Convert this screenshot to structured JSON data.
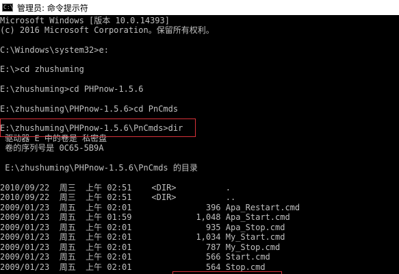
{
  "window": {
    "title": "管理员: 命令提示符",
    "icon": "cmd-window-icon",
    "icon_text": "C:\\"
  },
  "console": {
    "text_color": "#c0c0c0",
    "background": "#000000",
    "highlight_color": "#d9323a",
    "lines": [
      "Microsoft Windows [版本 10.0.14393]",
      "(c) 2016 Microsoft Corporation。保留所有权利。",
      "",
      "C:\\Windows\\system32>e:",
      "",
      "E:\\>cd zhushuming",
      "",
      "E:\\zhushuming>cd PHPnow-1.5.6",
      "",
      "E:\\zhushuming\\PHPnow-1.5.6>cd PnCmds",
      "",
      "E:\\zhushuming\\PHPnow-1.5.6\\PnCmds>dir",
      " 驱动器 E 中的卷是 私密盘",
      " 卷的序列号是 0C65-5B9A",
      "",
      " E:\\zhushuming\\PHPnow-1.5.6\\PnCmds 的目录",
      "",
      "2010/09/22  周三  上午 02:51    <DIR>          .",
      "2010/09/22  周三  上午 02:51    <DIR>          ..",
      "2009/01/23  周五  上午 02:01               396 Apa_Restart.cmd",
      "2009/01/23  周五  上午 01:59             1,048 Apa_Start.cmd",
      "2009/01/23  周五  上午 02:01               935 Apa_Stop.cmd",
      "2009/01/23  周五  上午 02:01             1,034 My_Start.cmd",
      "2009/01/23  周五  上午 02:01               787 My_Stop.cmd",
      "2009/01/23  周五  上午 02:01               566 Start.cmd",
      "2009/01/23  周五  上午 02:01               564 Stop.cmd"
    ]
  }
}
